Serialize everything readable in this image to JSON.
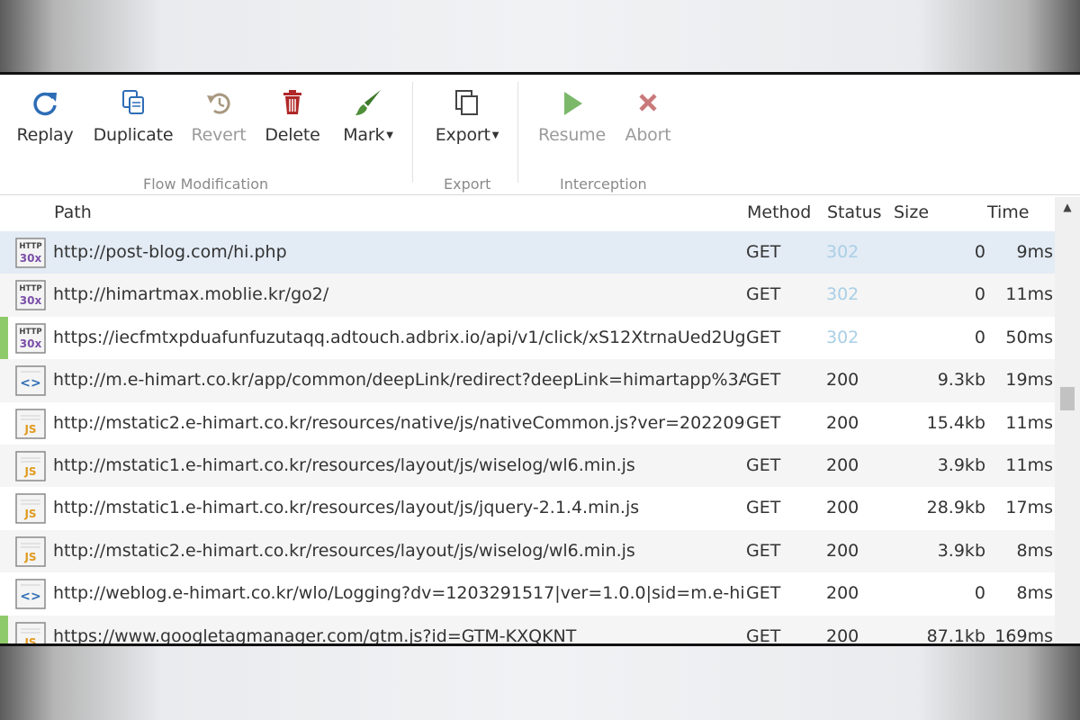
{
  "ribbon": {
    "flow_group": {
      "label": "Flow Modification",
      "buttons": [
        {
          "label": "Replay",
          "icon": "replay-icon",
          "enabled": true
        },
        {
          "label": "Duplicate",
          "icon": "duplicate-icon",
          "enabled": true
        },
        {
          "label": "Revert",
          "icon": "revert-icon",
          "enabled": false
        },
        {
          "label": "Delete",
          "icon": "trash-icon",
          "enabled": true
        },
        {
          "label": "Mark",
          "icon": "brush-icon",
          "enabled": true,
          "dropdown": true
        }
      ]
    },
    "export_group": {
      "label": "Export",
      "buttons": [
        {
          "label": "Export",
          "icon": "copy-icon",
          "enabled": true,
          "dropdown": true
        }
      ]
    },
    "interception_group": {
      "label": "Interception",
      "buttons": [
        {
          "label": "Resume",
          "icon": "play-icon",
          "enabled": false
        },
        {
          "label": "Abort",
          "icon": "x-icon",
          "enabled": false
        }
      ]
    }
  },
  "grid": {
    "columns": {
      "path": "Path",
      "method": "Method",
      "status": "Status",
      "size": "Size",
      "time": "Time"
    },
    "rows": [
      {
        "icon": "http-30x",
        "path": "http://post-blog.com/hi.php",
        "method": "GET",
        "status": "302",
        "size": "0",
        "time": "9ms"
      },
      {
        "icon": "http-30x",
        "path": "http://himartmax.moblie.kr/go2/",
        "method": "GET",
        "status": "302",
        "size": "0",
        "time": "11ms"
      },
      {
        "icon": "http-30x",
        "path": "https://iecfmtxpduafunfuzutaqq.adtouch.adbrix.io/api/v1/click/xS12XtrnaUed2Uga...",
        "method": "GET",
        "status": "302",
        "size": "0",
        "time": "50ms"
      },
      {
        "icon": "html",
        "path": "http://m.e-himart.co.kr/app/common/deepLink/redirect?deepLink=himartapp%3A...",
        "method": "GET",
        "status": "200",
        "size": "9.3kb",
        "time": "19ms"
      },
      {
        "icon": "js",
        "path": "http://mstatic2.e-himart.co.kr/resources/native/js/nativeCommon.js?ver=2022090...",
        "method": "GET",
        "status": "200",
        "size": "15.4kb",
        "time": "11ms"
      },
      {
        "icon": "js",
        "path": "http://mstatic1.e-himart.co.kr/resources/layout/js/wiselog/wl6.min.js",
        "method": "GET",
        "status": "200",
        "size": "3.9kb",
        "time": "11ms"
      },
      {
        "icon": "js",
        "path": "http://mstatic1.e-himart.co.kr/resources/layout/js/jquery-2.1.4.min.js",
        "method": "GET",
        "status": "200",
        "size": "28.9kb",
        "time": "17ms"
      },
      {
        "icon": "js",
        "path": "http://mstatic2.e-himart.co.kr/resources/layout/js/wiselog/wl6.min.js",
        "method": "GET",
        "status": "200",
        "size": "3.9kb",
        "time": "8ms"
      },
      {
        "icon": "html",
        "path": "http://weblog.e-himart.co.kr/wlo/Logging?dv=1203291517|ver=1.0.0|sid=m.e-him...",
        "method": "GET",
        "status": "200",
        "size": "0",
        "time": "8ms"
      },
      {
        "icon": "js",
        "path": "https://www.googletagmanager.com/gtm.js?id=GTM-KXQKNT",
        "method": "GET",
        "status": "200",
        "size": "87.1kb",
        "time": "169ms"
      }
    ]
  },
  "icon_text": {
    "http": "HTTP",
    "redirect": "30x",
    "js": "JS",
    "html": "<>"
  },
  "colors": {
    "marker_green": "#8fca6a",
    "status_redirect": "#a9cfe6",
    "selected_row": "#e3ebf5"
  }
}
